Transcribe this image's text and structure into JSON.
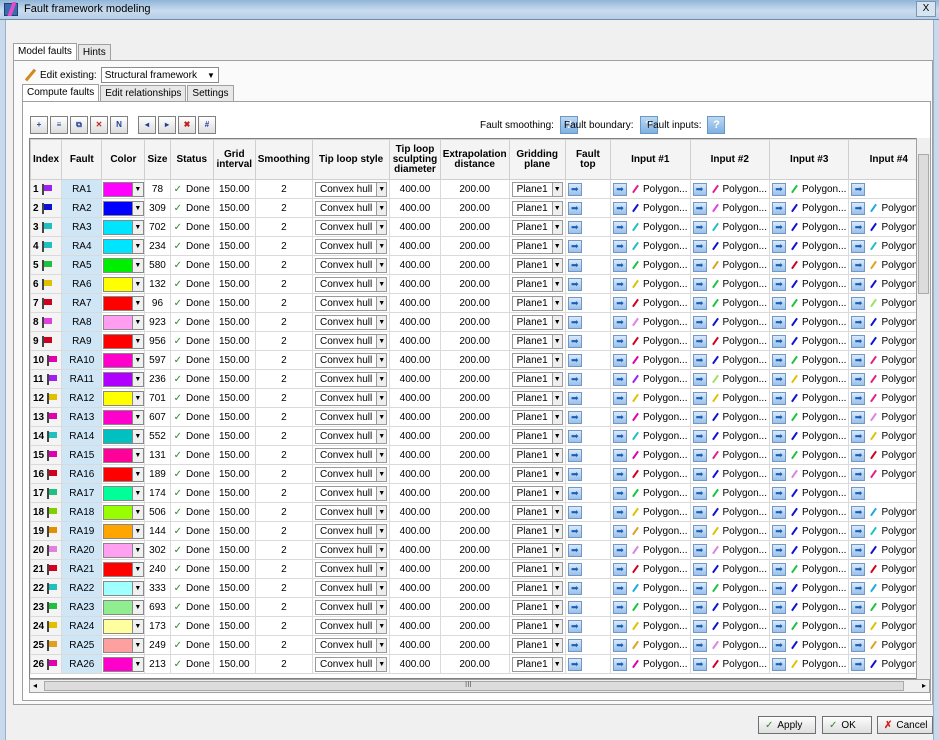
{
  "window": {
    "title": "Fault framework modeling",
    "close_label": "X"
  },
  "outer_tabs": [
    {
      "label": "Model faults"
    },
    {
      "label": "Hints"
    }
  ],
  "edit_existing": {
    "label": "Edit existing:",
    "value": "Structural framework"
  },
  "inner_tabs": [
    {
      "label": "Compute faults"
    },
    {
      "label": "Edit relationships"
    },
    {
      "label": "Settings"
    }
  ],
  "toolbar_icons": [
    "add-fault-icon",
    "insert-fault-icon",
    "duplicate-fault-icon",
    "delete-fault-icon",
    "rename-fault-icon",
    "move-up-icon",
    "move-down-icon",
    "clear-icon",
    "grid-settings-icon"
  ],
  "help": {
    "fault_smoothing": "Fault smoothing:",
    "fault_boundary": "Fault boundary:",
    "fault_inputs": "Fault inputs:",
    "q": "?"
  },
  "columns": [
    "Index",
    "Fault",
    "Color",
    "Size",
    "Status",
    "Grid interval",
    "Smoothing",
    "Tip loop style",
    "Tip loop sculpting diameter",
    "Extrapolation distance",
    "Gridding plane",
    "Fault top",
    "Input #1",
    "Input #2",
    "Input #3",
    "Input #4"
  ],
  "common": {
    "status": "Done",
    "grid_interval": "150.00",
    "smoothing": "2",
    "tip_loop_style": "Convex hull",
    "tip_loop_diameter": "400.00",
    "extrapolation": "200.00",
    "gridding_plane": "Plane1",
    "polygon": "Polygon..."
  },
  "rows": [
    {
      "index": "1",
      "fault": "RA1",
      "color": "#ff00ff",
      "size": "78",
      "flag": "#a020f0",
      "inputs": [
        "#e0208a",
        "#e0208a",
        "#20c040",
        ""
      ]
    },
    {
      "index": "2",
      "fault": "RA2",
      "color": "#0000ff",
      "size": "309",
      "flag": "#1010d0",
      "inputs": [
        "#1010d0",
        "#e040e0",
        "#1010d0",
        "#20a8e0"
      ]
    },
    {
      "index": "3",
      "fault": "RA3",
      "color": "#00e5ff",
      "size": "702",
      "flag": "#20c0c0",
      "inputs": [
        "#20c0c0",
        "#20c0c0",
        "#1010d0",
        "#1010d0"
      ]
    },
    {
      "index": "4",
      "fault": "RA4",
      "color": "#00e5ff",
      "size": "234",
      "flag": "#20c0c0",
      "inputs": [
        "#20c0c0",
        "#1010d0",
        "#1010d0",
        "#20c0c0"
      ]
    },
    {
      "index": "5",
      "fault": "RA5",
      "color": "#00ee00",
      "size": "580",
      "flag": "#20c040",
      "inputs": [
        "#20c040",
        "#e0a020",
        "#d00020",
        "#e0a020"
      ]
    },
    {
      "index": "6",
      "fault": "RA6",
      "color": "#ffff00",
      "size": "132",
      "flag": "#e0c000",
      "inputs": [
        "#e0c000",
        "#20c040",
        "#1010d0",
        "#1010d0"
      ]
    },
    {
      "index": "7",
      "fault": "RA7",
      "color": "#ff0000",
      "size": "96",
      "flag": "#d00020",
      "inputs": [
        "#d00020",
        "#20c040",
        "#20c040",
        "#a0e060"
      ]
    },
    {
      "index": "8",
      "fault": "RA8",
      "color": "#ff9ef0",
      "size": "923",
      "flag": "#e040e0",
      "inputs": [
        "#e080e0",
        "#1010d0",
        "#1010d0",
        "#1010d0"
      ]
    },
    {
      "index": "9",
      "fault": "RA9",
      "color": "#ff0000",
      "size": "956",
      "flag": "#d00020",
      "inputs": [
        "#d00020",
        "#d00020",
        "#1010d0",
        "#1010d0"
      ]
    },
    {
      "index": "10",
      "fault": "RA10",
      "color": "#ff00cc",
      "size": "597",
      "flag": "#e000b0",
      "inputs": [
        "#e000b0",
        "#1010d0",
        "#20c040",
        "#e0208a"
      ]
    },
    {
      "index": "11",
      "fault": "RA11",
      "color": "#b000ff",
      "size": "236",
      "flag": "#a020f0",
      "inputs": [
        "#a020f0",
        "#a0e060",
        "#e0c000",
        "#e0208a"
      ]
    },
    {
      "index": "12",
      "fault": "RA12",
      "color": "#ffff00",
      "size": "701",
      "flag": "#e0c000",
      "inputs": [
        "#e0c000",
        "#e0c000",
        "#1010d0",
        "#e0208a"
      ]
    },
    {
      "index": "13",
      "fault": "RA13",
      "color": "#ff00cc",
      "size": "607",
      "flag": "#e000b0",
      "inputs": [
        "#e000b0",
        "#1010d0",
        "#20c040",
        "#e080e0"
      ]
    },
    {
      "index": "14",
      "fault": "RA14",
      "color": "#00c0c0",
      "size": "552",
      "flag": "#20c0c0",
      "inputs": [
        "#20c0c0",
        "#1010d0",
        "#1010d0",
        "#e0c000"
      ]
    },
    {
      "index": "15",
      "fault": "RA15",
      "color": "#ff0099",
      "size": "131",
      "flag": "#e000b0",
      "inputs": [
        "#e000b0",
        "#e0208a",
        "#20c040",
        "#d00020"
      ]
    },
    {
      "index": "16",
      "fault": "RA16",
      "color": "#ff0000",
      "size": "189",
      "flag": "#d00020",
      "inputs": [
        "#d00020",
        "#1010d0",
        "#e080e0",
        "#e0208a"
      ]
    },
    {
      "index": "17",
      "fault": "RA17",
      "color": "#00ff99",
      "size": "174",
      "flag": "#20c080",
      "inputs": [
        "#20c040",
        "#20c040",
        "#1010d0",
        ""
      ]
    },
    {
      "index": "18",
      "fault": "RA18",
      "color": "#99ff00",
      "size": "506",
      "flag": "#80d000",
      "inputs": [
        "#e0c000",
        "#1010d0",
        "#1010d0",
        "#20a8e0"
      ]
    },
    {
      "index": "19",
      "fault": "RA19",
      "color": "#ffa500",
      "size": "144",
      "flag": "#e09000",
      "inputs": [
        "#e0a020",
        "#e0c000",
        "#1010d0",
        "#20c0c0"
      ]
    },
    {
      "index": "20",
      "fault": "RA20",
      "color": "#ffa0f0",
      "size": "302",
      "flag": "#e080e0",
      "inputs": [
        "#e080e0",
        "#e080e0",
        "#1010d0",
        "#1010d0"
      ]
    },
    {
      "index": "21",
      "fault": "RA21",
      "color": "#ff0000",
      "size": "240",
      "flag": "#d00020",
      "inputs": [
        "#d00020",
        "#1010d0",
        "#20c040",
        "#d00020"
      ]
    },
    {
      "index": "22",
      "fault": "RA22",
      "color": "#a0ffff",
      "size": "333",
      "flag": "#20c0c0",
      "inputs": [
        "#20a8e0",
        "#20c040",
        "#1010d0",
        "#20a8e0"
      ]
    },
    {
      "index": "23",
      "fault": "RA23",
      "color": "#90ee90",
      "size": "693",
      "flag": "#20c040",
      "inputs": [
        "#20c040",
        "#1010d0",
        "#1010d0",
        "#20c040"
      ]
    },
    {
      "index": "24",
      "fault": "RA24",
      "color": "#ffffa0",
      "size": "173",
      "flag": "#e0c000",
      "inputs": [
        "#e0c000",
        "#1010d0",
        "#20c040",
        "#e0c000"
      ]
    },
    {
      "index": "25",
      "fault": "RA25",
      "color": "#ffa0a0",
      "size": "249",
      "flag": "#e0a020",
      "inputs": [
        "#e0a020",
        "#e080e0",
        "#1010d0",
        "#e0a020"
      ]
    },
    {
      "index": "26",
      "fault": "RA26",
      "color": "#ff00cc",
      "size": "213",
      "flag": "#e000b0",
      "inputs": [
        "#e000b0",
        "#d00020",
        "#e0c000",
        "#1010d0"
      ]
    }
  ],
  "footer": {
    "apply": "Apply",
    "ok": "OK",
    "cancel": "Cancel"
  },
  "scroll_mark": "III"
}
